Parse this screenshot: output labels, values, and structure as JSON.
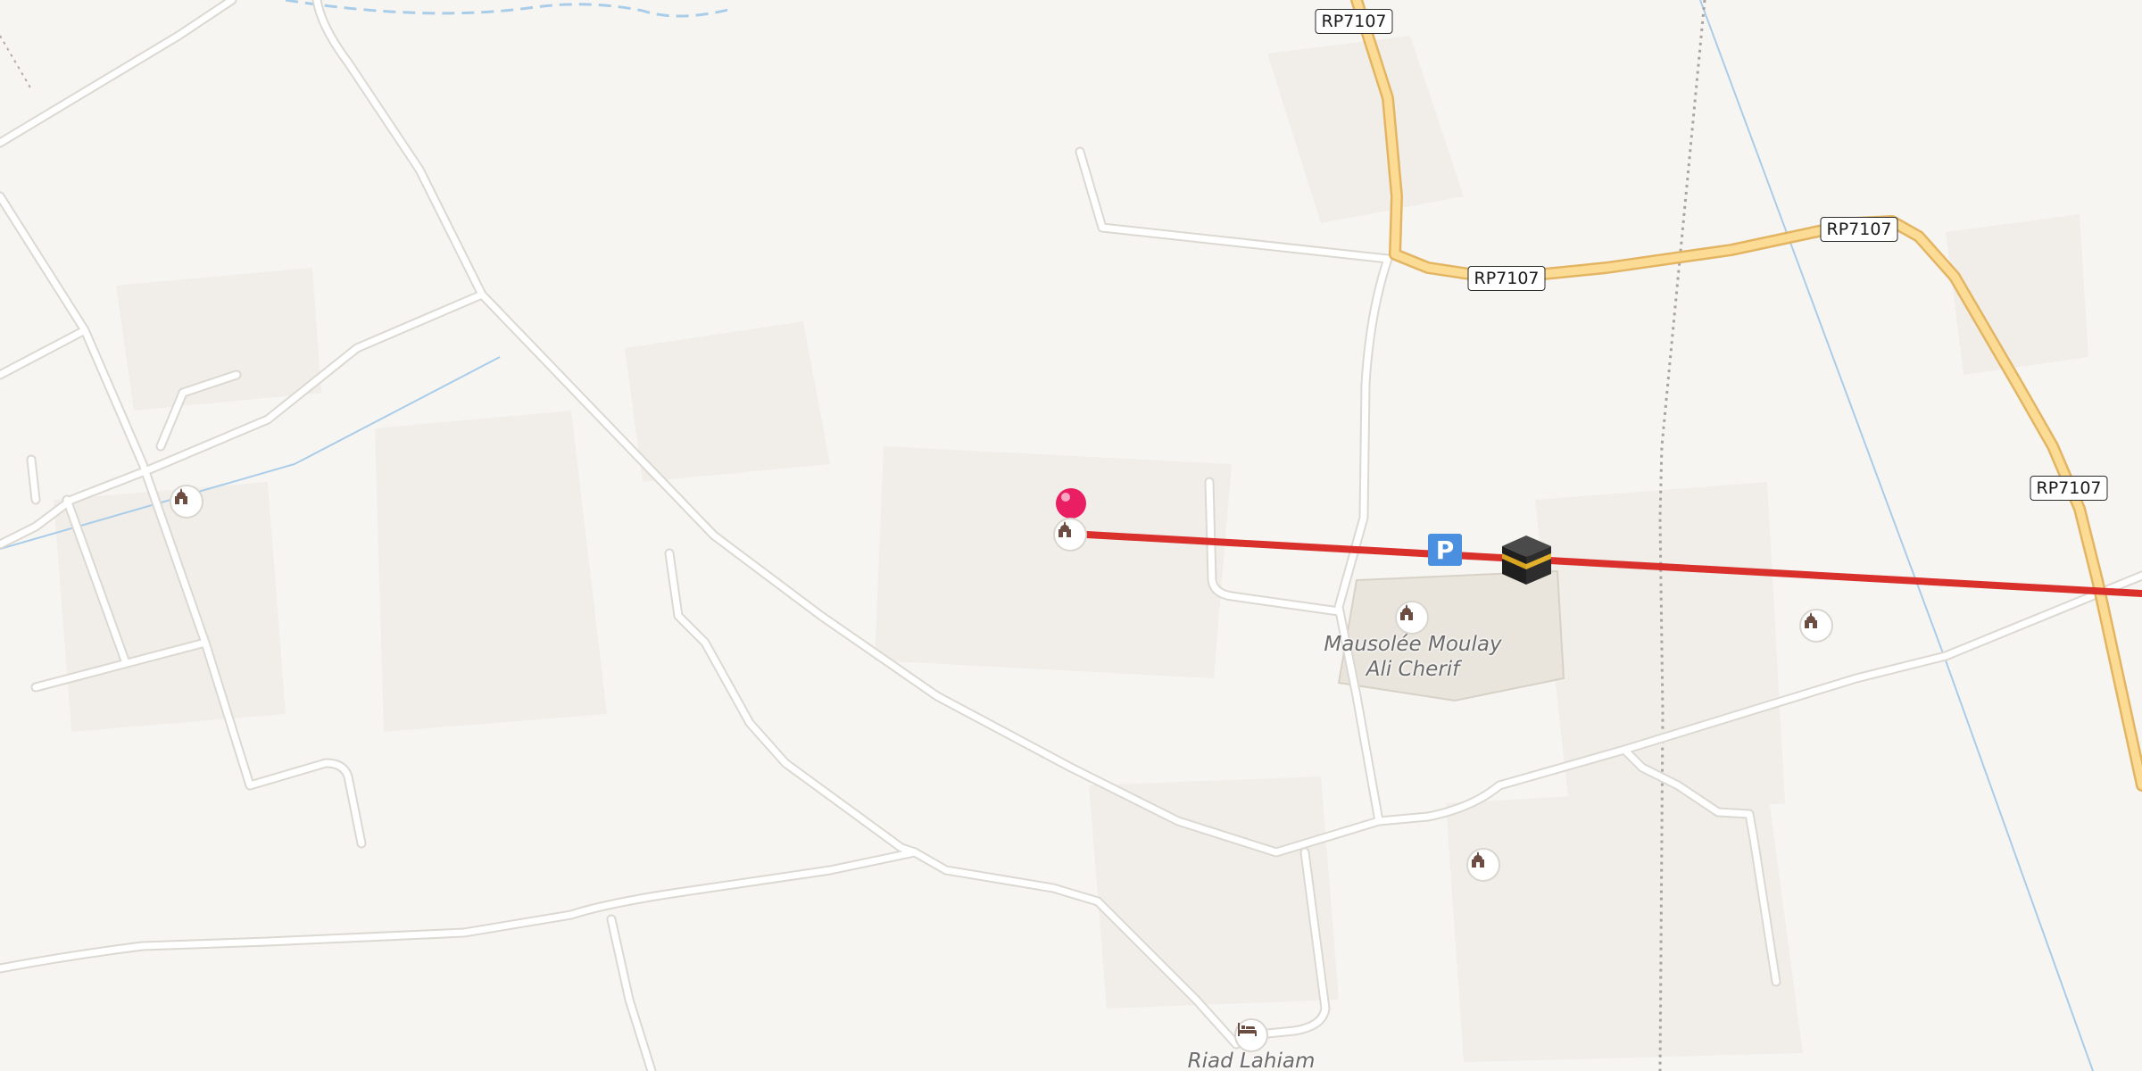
{
  "map": {
    "road_ref": "RP7107",
    "places": {
      "mausoleum": {
        "line1": "Mausolée Moulay",
        "line2": "Ali Cherif"
      },
      "riad": "Riad Lahiam"
    },
    "icons": {
      "mosque": "mosque-icon",
      "lodging": "bed-icon",
      "parking": "parking-icon",
      "marker": "location-pin-icon",
      "landmark": "kaaba-icon"
    },
    "parking_letter": "P",
    "colors": {
      "background": "#f7f5f2",
      "minor_road": "#ffffff",
      "road_casing": "#dcd8d2",
      "primary_road": "#fcdc94",
      "primary_casing": "#e3b563",
      "route_line": "#d9302c",
      "marker": "#e91e63",
      "waterway": "#a9cde9",
      "landuse": "#ebe6df"
    }
  }
}
